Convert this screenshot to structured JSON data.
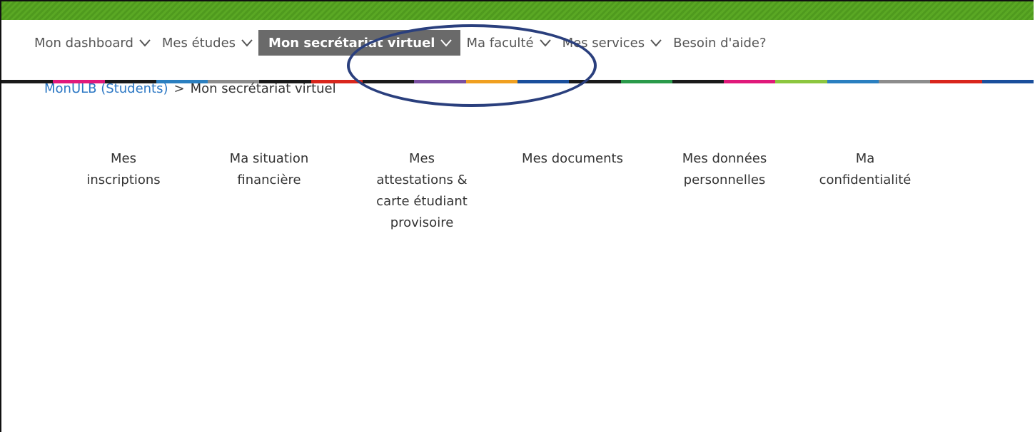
{
  "nav": {
    "items": [
      {
        "label": "Mon dashboard",
        "has_chevron": true
      },
      {
        "label": "Mes études",
        "has_chevron": true
      },
      {
        "label": "Mon secrétariat virtuel",
        "has_chevron": true,
        "active": true
      },
      {
        "label": "Ma faculté",
        "has_chevron": true
      },
      {
        "label": "Mes services",
        "has_chevron": true
      },
      {
        "label": "Besoin d'aide?",
        "has_chevron": false
      }
    ],
    "active_bg": "#6a6a6a",
    "chevron_icon": "chevron-down-icon"
  },
  "colors": {
    "top_bar": "#4f9a1e",
    "annotation_circle": "#2a3f7d",
    "link": "#2b77c4"
  },
  "breadcrumb": {
    "root": "MonULB (Students)",
    "separator": ">",
    "current": "Mon secrétariat virtuel"
  },
  "tiles": [
    {
      "lines": [
        "Mes",
        "inscriptions"
      ]
    },
    {
      "lines": [
        "Ma situation",
        "financière"
      ]
    },
    {
      "lines": [
        "Mes",
        "attestations &",
        "carte étudiant",
        "provisoire"
      ]
    },
    {
      "lines": [
        "Mes documents"
      ]
    },
    {
      "lines": [
        "Mes données",
        "personnelles"
      ]
    },
    {
      "lines": [
        "Ma",
        "confidentialité"
      ]
    }
  ]
}
